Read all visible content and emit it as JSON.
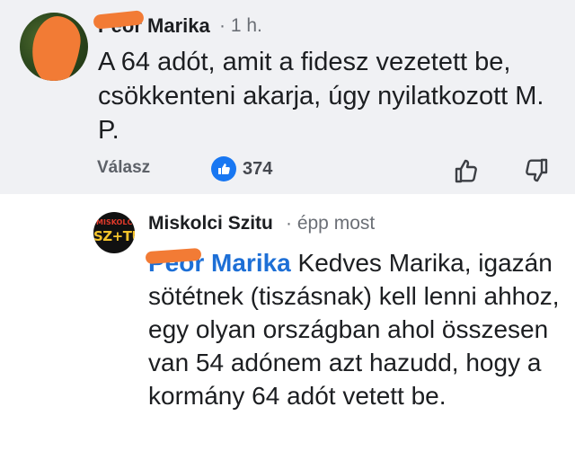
{
  "comment1": {
    "author": "Peór Marika",
    "time": "· 1 h.",
    "text": "A 64 adót, amit a fidesz vezetett be, csökkenteni akarja, úgy nyilatkozott M. P.",
    "reply_label": "Válasz",
    "like_count": "374"
  },
  "comment2": {
    "author": "Miskolci Szitu",
    "time": "· épp most",
    "mention": "Peór Marika",
    "text": " Kedves Marika, igazán sötétnek (tiszásnak) kell lenni ahhoz, egy olyan országban ahol összesen van 54 adónem azt hazudd, hogy a kormány 64 adót vetett be.",
    "avatar_line1": "MISKOLCI",
    "avatar_line2": "SZ+TU"
  },
  "colors": {
    "accent": "#1877f2",
    "mention": "#1d6fd6",
    "redaction": "#f27b35",
    "highlight_bg": "#f0f1f4"
  }
}
